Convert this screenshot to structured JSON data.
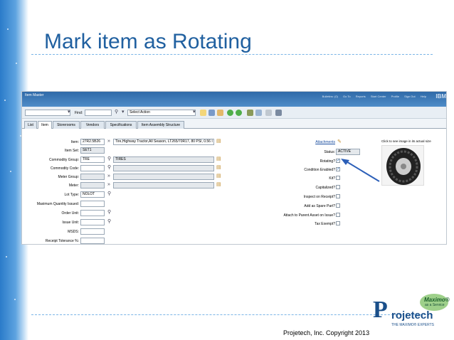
{
  "slide": {
    "title": "Mark item as Rotating",
    "copyright": "Projetech, Inc. Copyright 2013",
    "logo": {
      "initial": "P",
      "name": "rojetech",
      "tagline": "THE MAXIMO® EXPERTS",
      "bubble_title": "Maximo®",
      "bubble_sub": "as a Service"
    }
  },
  "app": {
    "title": "Item Master",
    "top_links": [
      "Bulletins: (0)",
      "Go To",
      "Reports",
      "Start Center",
      "Profile",
      "Sign Out",
      "Help"
    ],
    "brand": "IBM"
  },
  "toolbar": {
    "find_label": "Find:",
    "select_action": "Select Action"
  },
  "tabs": [
    "List",
    "Item",
    "Storerooms",
    "Vendors",
    "Specifications",
    "Item Assembly Structure"
  ],
  "form": {
    "item": {
      "label": "Item:",
      "value": "27R2.5B26",
      "description": "Tire,Highway Tractor,All Season, LT265/70R17, 80 PSI, 0.56 I"
    },
    "item_set": {
      "label": "Item Set:",
      "value": "SET1"
    },
    "commodity_group": {
      "label": "Commodity Group:",
      "value": "TRE",
      "description": "TIRES"
    },
    "commodity_code": {
      "label": "Commodity Code:",
      "value": ""
    },
    "meter_group": {
      "label": "Meter Group:",
      "value": ""
    },
    "meter": {
      "label": "Meter:",
      "value": ""
    },
    "lot_type": {
      "label": "Lot Type:",
      "value": "NOLOT"
    },
    "max_qty_issued": {
      "label": "Maximum Quantity Issued:",
      "value": ""
    },
    "order_unit": {
      "label": "Order Unit:",
      "value": ""
    },
    "issue_unit": {
      "label": "Issue Unit:",
      "value": ""
    },
    "msds": {
      "label": "MSDS:",
      "value": ""
    },
    "receipt_tolerance": {
      "label": "Receipt Tolerance %:",
      "value": ""
    },
    "attachments_label": "Attachments",
    "status": {
      "label": "Status:",
      "value": "ACTIVE"
    },
    "rotating": {
      "label": "Rotating?",
      "checked": true
    },
    "condition_enabled": {
      "label": "Condition Enabled?",
      "checked": true
    },
    "kit": {
      "label": "Kit?",
      "checked": false
    },
    "capitalized": {
      "label": "Capitalized?",
      "checked": false
    },
    "inspect_on_receipt": {
      "label": "Inspect on Receipt?",
      "checked": false
    },
    "add_as_spare_part": {
      "label": "Add as Spare Part?",
      "checked": false
    },
    "attach_to_parent": {
      "label": "Attach to Parent Asset on Issue?",
      "checked": false
    },
    "tax_exempt": {
      "label": "Tax Exempt?",
      "checked": false
    },
    "image_caption": "Click to see image in its actual size"
  },
  "colors": {
    "title": "#2060a0",
    "arrow": "#2c5fb8",
    "header": "#2f6aa8"
  }
}
